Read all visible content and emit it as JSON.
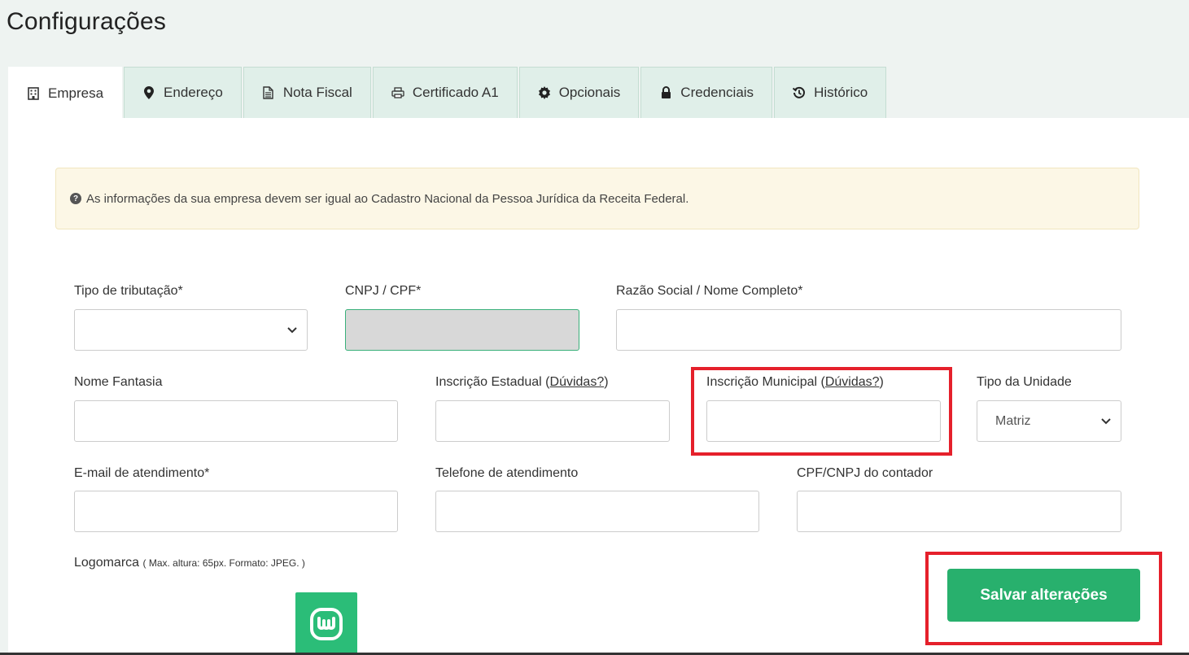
{
  "page": {
    "title": "Configurações"
  },
  "tabs": [
    {
      "label": "Empresa",
      "icon": "building-icon",
      "active": true
    },
    {
      "label": "Endereço",
      "icon": "map-marker-icon"
    },
    {
      "label": "Nota Fiscal",
      "icon": "document-icon"
    },
    {
      "label": "Certificado A1",
      "icon": "printer-icon"
    },
    {
      "label": "Opcionais",
      "icon": "gear-icon"
    },
    {
      "label": "Credenciais",
      "icon": "lock-icon"
    },
    {
      "label": "Histórico",
      "icon": "history-icon"
    }
  ],
  "alert": {
    "text": "As informações da sua empresa devem ser igual ao Cadastro Nacional da Pessoa Jurídica da Receita Federal."
  },
  "form": {
    "tipo_tributacao": {
      "label": "Tipo de tributação*",
      "value": ""
    },
    "cnpj_cpf": {
      "label": "CNPJ / CPF*"
    },
    "razao_social": {
      "label": "Razão Social / Nome Completo*",
      "value": ""
    },
    "nome_fantasia": {
      "label": "Nome Fantasia",
      "value": ""
    },
    "inscricao_estadual": {
      "label": "Inscrição Estadual",
      "help": "Dúvidas?",
      "value": ""
    },
    "inscricao_municipal": {
      "label": "Inscrição Municipal",
      "help": "Dúvidas?",
      "value": ""
    },
    "tipo_unidade": {
      "label": "Tipo da Unidade",
      "value": "Matriz"
    },
    "email_atendimento": {
      "label": "E-mail de atendimento*",
      "value": ""
    },
    "telefone_atendimento": {
      "label": "Telefone de atendimento",
      "value": ""
    },
    "cpf_cnpj_contador": {
      "label": "CPF/CNPJ do contador",
      "value": ""
    },
    "logomarca": {
      "label": "Logomarca",
      "hint": "( Max. altura: 65px. Formato: JPEG. )"
    }
  },
  "actions": {
    "save_label": "Salvar alterações"
  },
  "colors": {
    "accent": "#28b06d",
    "highlight": "#e5202b",
    "alert_bg": "#fcf7e6",
    "tab_bg": "#e0efe9"
  }
}
